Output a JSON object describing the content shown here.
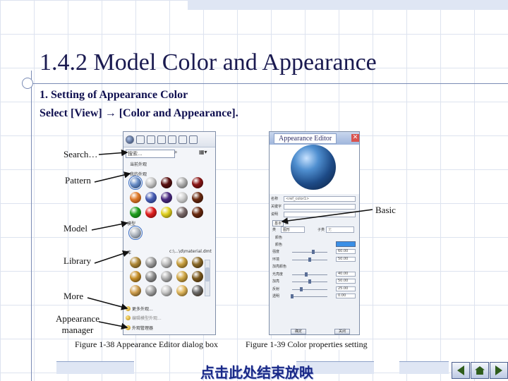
{
  "slide": {
    "title": "1.4.2  Model Color and Appearance",
    "para1": "1. Setting of Appearance Color",
    "para2": "Select [View] → [Color and Appearance].",
    "footer_link": "点击此处结束放映"
  },
  "labels": {
    "search": "Search…",
    "pattern": "Pattern",
    "model": "Model",
    "library": "Library",
    "more": "More",
    "appearance_manager_1": "Appearance",
    "appearance_manager_2": "manager",
    "basic": "Basic"
  },
  "captions": {
    "fig38": "Figure 1-38 Appearance Editor dialog box",
    "fig39": "Figure 1-39 Color properties setting"
  },
  "dialog_left": {
    "search_value": "搜索...",
    "scope_label": "当前外观",
    "section_my": "我的外观",
    "section_model": "模型",
    "section_library": "库",
    "library_file": "c:\\...\\d\\material.dmt",
    "item_more": "更多外观...",
    "item_edit": "编辑模型外观...",
    "item_manager": "外观管理器"
  },
  "dialog_right": {
    "title": "Appearance Editor",
    "close": "✕",
    "field_name_label": "名称",
    "field_name_value": "<ref_color1>",
    "field_keyword_label": "关键字",
    "field_desc_label": "说明",
    "tab_basic": "基本",
    "tab_map": "图",
    "class_label": "类",
    "class_value": "图形",
    "sub_label": "子类",
    "sub_value": "无",
    "color_label": "颜色",
    "color_section": "颜色",
    "sliders": [
      {
        "label": "强度",
        "value": "60.00",
        "pos": 0.6
      },
      {
        "label": "环境",
        "value": "50.00",
        "pos": 0.5
      },
      {
        "label": "加亮颜色",
        "value": "",
        "pos": null
      },
      {
        "label": "光亮度",
        "value": "40.00",
        "pos": 0.4
      },
      {
        "label": "加亮",
        "value": "50.00",
        "pos": 0.5
      },
      {
        "label": "反射",
        "value": "25.00",
        "pos": 0.25
      },
      {
        "label": "透明",
        "value": "0.00",
        "pos": 0.0
      }
    ],
    "ok": "确定",
    "cancel": "关闭"
  },
  "colors": {
    "accent": "#1a1a50",
    "link": "#1b2a88",
    "swatch": "#3a8fe6",
    "grid": "#dde3ef"
  },
  "icons": [
    "sphere-icon",
    "zoom-in-icon",
    "zoom-out-icon",
    "repaint-icon",
    "view-icon",
    "appearance-icon",
    "search-icon",
    "prev-icon",
    "home-icon",
    "next-icon"
  ]
}
